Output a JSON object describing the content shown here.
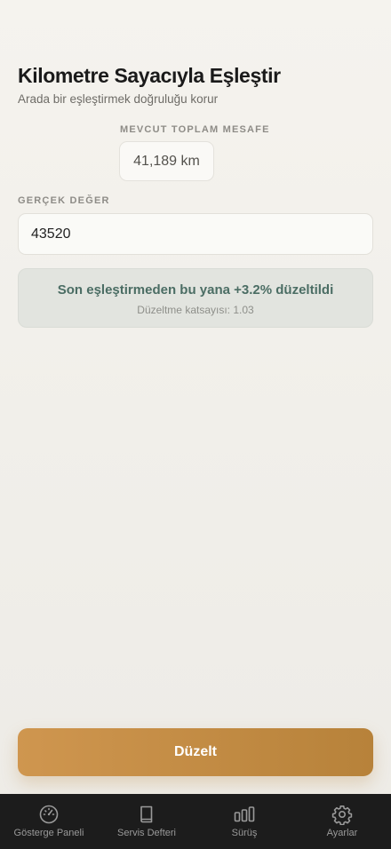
{
  "header": {
    "title": "Kilometre Sayacıyla Eşleştir",
    "subtitle": "Arada bir eşleştirmek doğruluğu korur"
  },
  "current": {
    "label": "MEVCUT TOPLAM MESAFE",
    "value": "41,189 km"
  },
  "actual": {
    "label": "GERÇEK DEĞER",
    "value": "43520"
  },
  "info": {
    "main": "Son eşleştirmeden bu yana +3.2% düzeltildi",
    "sub": "Düzeltme katsayısı: 1.03"
  },
  "action": {
    "label": "Düzelt"
  },
  "tabs": [
    {
      "label": "Gösterge Paneli",
      "icon": "speedometer-icon"
    },
    {
      "label": "Servis Defteri",
      "icon": "book-icon"
    },
    {
      "label": "Sürüş",
      "icon": "bar-chart-icon"
    },
    {
      "label": "Ayarlar",
      "icon": "gear-icon"
    }
  ],
  "colors": {
    "accent": "#c68c45",
    "info_text": "#4b6d64",
    "tabbar_bg": "#1c1c1c"
  }
}
